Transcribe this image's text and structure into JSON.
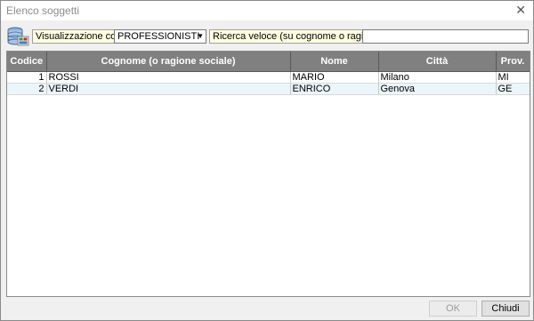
{
  "window": {
    "title": "Elenco soggetti",
    "close_glyph": "✕"
  },
  "toolbar": {
    "view_label": "Visualizzazione corrente:",
    "view_value": "PROFESSIONISTI",
    "search_label": "Ricerca veloce (su cognome o ragione sociale):",
    "search_value": ""
  },
  "table": {
    "columns": [
      "Codice",
      "Cognome (o ragione sociale)",
      "Nome",
      "Città",
      "Prov."
    ],
    "rows": [
      {
        "code": "1",
        "surname": "ROSSI",
        "name": "MARIO",
        "city": "Milano",
        "prov": "MI"
      },
      {
        "code": "2",
        "surname": "VERDI",
        "name": "ENRICO",
        "city": "Genova",
        "prov": "GE"
      }
    ]
  },
  "buttons": {
    "ok": "OK",
    "close": "Chiudi"
  }
}
